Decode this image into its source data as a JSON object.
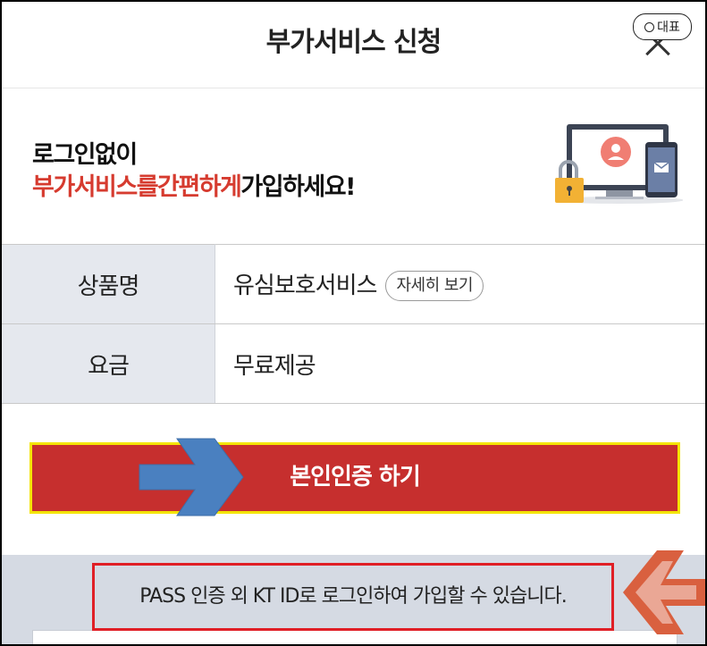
{
  "header": {
    "title": "부가서비스 신청",
    "badge_label": "대표"
  },
  "promo": {
    "line1": "로그인없이",
    "line2_highlight": "부가서비스를간편하게",
    "line2_rest": "가입하세요!"
  },
  "info": {
    "rows": [
      {
        "label": "상품명",
        "value": "유심보호서비스",
        "action": "자세히 보기"
      },
      {
        "label": "요금",
        "value": "무료제공"
      }
    ]
  },
  "verify_button": {
    "label": "본인인증 하기"
  },
  "notice": {
    "text": "PASS 인증 외 KT ID로 로그인하여 가입할 수 있습니다."
  },
  "colors": {
    "accent_red": "#c62f2e",
    "highlight_red": "#d63b2f",
    "callout_yellow": "#f4e400",
    "callout_red": "#e01f26",
    "arrow_blue": "#4a80c0",
    "arrow_orange": "#d9603f"
  },
  "icons": [
    "close-icon",
    "search-icon",
    "login-illustration-icon",
    "arrow-right-icon",
    "arrow-left-icon"
  ]
}
